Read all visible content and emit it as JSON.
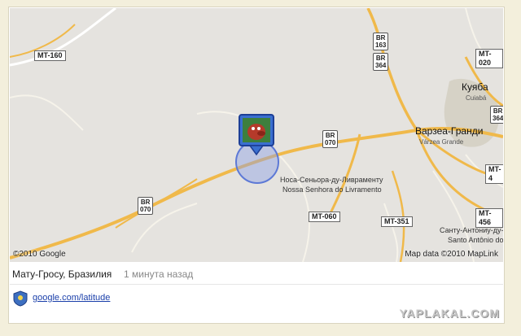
{
  "map": {
    "copyright_left": "©2010 Google",
    "copyright_right": "Map data ©2010 MapLink",
    "road_labels": [
      {
        "text": "MT-160",
        "kind": "plate"
      },
      {
        "text": "MT-020",
        "kind": "plate"
      },
      {
        "text": "MT-060",
        "kind": "plate"
      },
      {
        "text": "MT-351",
        "kind": "plate"
      },
      {
        "text": "MT-456",
        "kind": "plate"
      },
      {
        "text": "MT-4",
        "kind": "plate"
      }
    ],
    "br_shields": [
      {
        "top": "BR",
        "num": "163"
      },
      {
        "top": "BR",
        "num": "364"
      },
      {
        "top": "BR",
        "num": "070"
      },
      {
        "top": "BR",
        "num": "070"
      },
      {
        "top": "BR",
        "num": "364"
      }
    ],
    "places": {
      "cuiaba_ru": "Куяба",
      "cuiaba": "Cuiabá",
      "varzea_ru": "Варзеа-Гранди",
      "varzea": "Várzea Grande",
      "livramento_ru": "Носа-Сеньора-ду-Ливраменту",
      "livramento": "Nossa Senhora do Livramento",
      "santo_ru": "Санту-Антониу-ду-",
      "santo": "Santo Antônio do"
    },
    "colors": {
      "highway": "#f0b94a",
      "minor_road": "#ffffff",
      "land": "#e5e3df",
      "accuracy_circle": "#5d79d6"
    }
  },
  "status": {
    "location": "Мату-Гросу, Бразилия",
    "time_ago": "1 минута назад"
  },
  "footer": {
    "link": "google.com/latitude",
    "watermark": "YAPLAKAL.COM"
  }
}
